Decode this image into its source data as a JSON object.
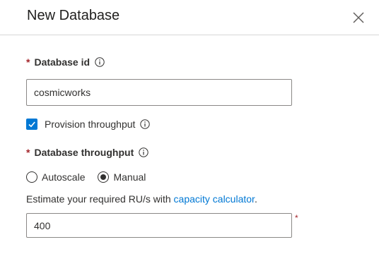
{
  "header": {
    "title": "New Database",
    "close_icon": "close-icon"
  },
  "database_id": {
    "required_marker": "*",
    "label": "Database id",
    "info_icon": "info-icon",
    "value": "cosmicworks"
  },
  "provision_throughput": {
    "label": "Provision throughput",
    "checked": true,
    "info_icon": "info-icon"
  },
  "database_throughput": {
    "required_marker": "*",
    "label": "Database throughput",
    "info_icon": "info-icon",
    "options": [
      {
        "label": "Autoscale",
        "selected": false
      },
      {
        "label": "Manual",
        "selected": true
      }
    ]
  },
  "estimate": {
    "prefix": "Estimate your required RU/s with ",
    "link_text": "capacity calculator",
    "suffix": "."
  },
  "ru_input": {
    "value": "400",
    "required_marker": "*"
  },
  "colors": {
    "accent": "#0078d4",
    "required": "#a4262c",
    "text": "#323130"
  }
}
